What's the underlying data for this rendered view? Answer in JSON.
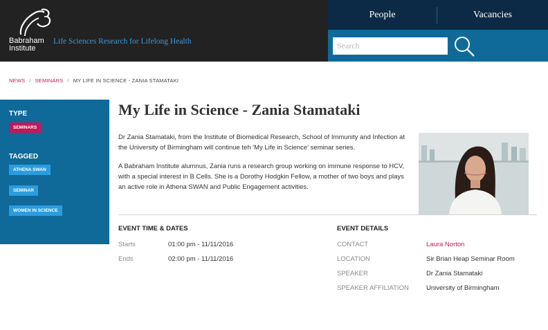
{
  "header": {
    "logo_line1": "Babraham",
    "logo_line2": "Institute",
    "tagline": "Life Sciences Research for Lifelong Health",
    "nav": [
      {
        "label": "People"
      },
      {
        "label": "Vacancies"
      }
    ],
    "search": {
      "placeholder": "Search",
      "value": "",
      "icon": "search-icon"
    }
  },
  "breadcrumb": {
    "items": [
      "NEWS",
      "SEMINARS"
    ],
    "separator": "/",
    "current": "MY LIFE IN SCIENCE - ZANIA STAMATAKI"
  },
  "sidebar": {
    "type_heading": "TYPE",
    "type_tags": [
      "SEMINARS"
    ],
    "tagged_heading": "TAGGED",
    "tagged_tags": [
      "ATHENA SWAN",
      "SEMINAR",
      "WOMEN IN SCIENCE"
    ]
  },
  "main": {
    "title": "My Life in Science - Zania Stamataki",
    "paragraph1": "Dr Zania Stamataki, from the Institute of Biomedical Research, School of Immunity and Infection at the University of Birmingham will continue teh 'My Life in Science' seminar series.",
    "paragraph2": "A Babraham Institute alumnus, Zania runs a research group working on immune response to HCV, with a special interest in B Cells. She is a Dorothy Hodgkin Fellow, a mother of two boys and plays an active role in Athena SWAN and Public Engagement activities."
  },
  "event_times": {
    "heading": "EVENT TIME & DATES",
    "rows": [
      {
        "label": "Starts",
        "value": "01:00 pm - 11/11/2016"
      },
      {
        "label": "Ends",
        "value": "02:00 pm - 11/11/2016"
      }
    ]
  },
  "event_details": {
    "heading": "EVENT DETAILS",
    "rows": [
      {
        "label": "CONTACT",
        "value": "Laura Norton"
      },
      {
        "label": "LOCATION",
        "value": "Sir Brian Heap Seminar Room"
      },
      {
        "label": "SPEAKER",
        "value": "Dr Zania Stamataki"
      },
      {
        "label": "SPEAKER AFFILIATION",
        "value": "University of Birmingham"
      }
    ]
  },
  "colors": {
    "header_dark": "#222222",
    "nav_dark": "#0c2a45",
    "brand_blue": "#0f6a9a",
    "accent_pink": "#c2185b",
    "tag_blue": "#2b9ddf",
    "tagline_blue": "#3a9ad9"
  }
}
